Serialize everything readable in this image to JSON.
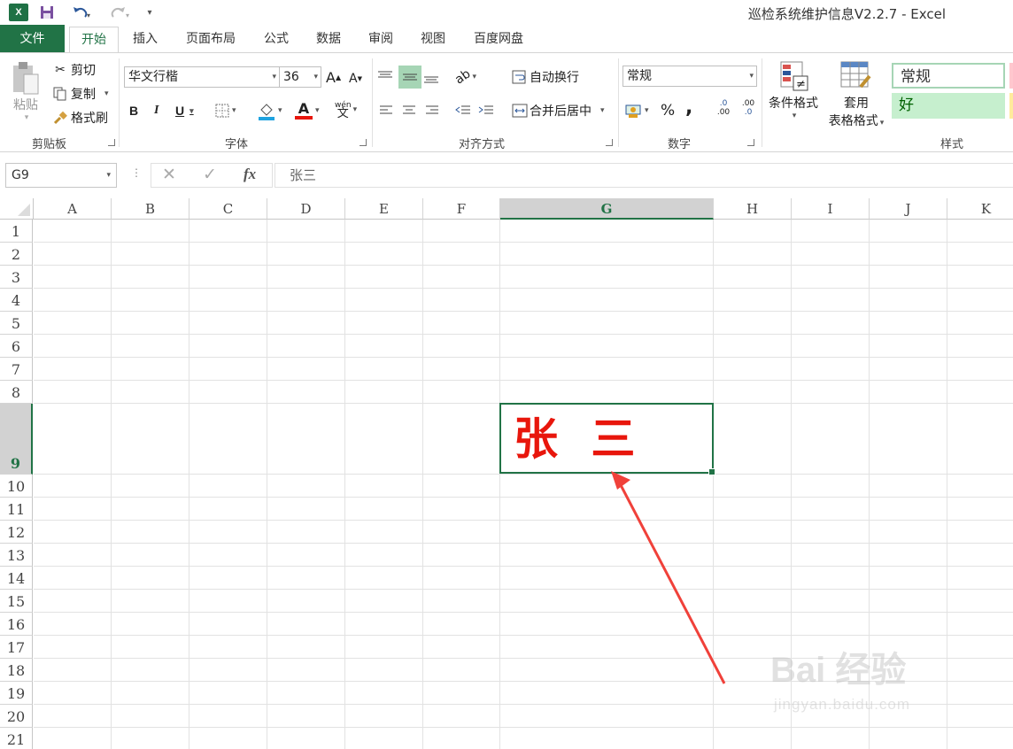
{
  "window": {
    "title": "巡检系统维护信息V2.2.7 - Excel",
    "app_icon": "X"
  },
  "tabs": [
    "文件",
    "开始",
    "插入",
    "页面布局",
    "公式",
    "数据",
    "审阅",
    "视图",
    "百度网盘"
  ],
  "ribbon": {
    "clipboard": {
      "paste": "粘贴",
      "cut": "剪切",
      "copy": "复制",
      "format_painter": "格式刷",
      "group": "剪贴板"
    },
    "font": {
      "name": "华文行楷",
      "size": "36",
      "bold": "B",
      "italic": "I",
      "underline": "U",
      "phonetic_top": "wén",
      "phonetic_bottom": "文",
      "font_color_letter": "A",
      "grow": "A",
      "shrink": "A",
      "group": "字体"
    },
    "alignment": {
      "wrap_text": "自动换行",
      "merge_center": "合并后居中",
      "group": "对齐方式"
    },
    "number": {
      "format": "常规",
      "percent": "%",
      "comma": ",",
      "inc_decimal_top": ".0",
      "inc_decimal_bottom": ".00",
      "dec_decimal_top": ".00",
      "dec_decimal_bottom": ".0",
      "group": "数字"
    },
    "styles": {
      "conditional": "条件格式",
      "table_line1": "套用",
      "table_line2": "表格格式",
      "normal": "常规",
      "good": "好",
      "group": "样式"
    }
  },
  "formula_bar": {
    "name_box": "G9",
    "fx": "fx",
    "value": "张三"
  },
  "sheet": {
    "columns": [
      "A",
      "B",
      "C",
      "D",
      "E",
      "F",
      "G",
      "H",
      "I",
      "J",
      "K"
    ],
    "selected_column": "G",
    "rows": [
      "1",
      "2",
      "3",
      "4",
      "5",
      "6",
      "7",
      "8",
      "9",
      "10",
      "11",
      "12",
      "13",
      "14",
      "15",
      "16",
      "17",
      "18",
      "19",
      "20",
      "21"
    ],
    "selected_row": "9",
    "active_cell_value": "张 三"
  },
  "colors": {
    "excel_green": "#217346",
    "cell_text": "#e8160c",
    "arrow": "#f0413a"
  },
  "watermark": {
    "main": "Bai 经验",
    "sub": "jingyan.baidu.com"
  }
}
